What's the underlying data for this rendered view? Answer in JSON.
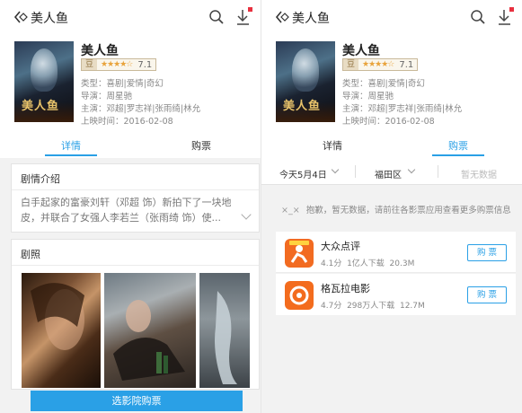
{
  "header": {
    "title": "美人鱼"
  },
  "movie": {
    "title": "美人鱼",
    "rating_source": "豆",
    "stars": "★★★★☆",
    "score": "7.1",
    "genre": "类型：喜剧|爱情|奇幻",
    "director": "导演：周星驰",
    "cast": "主演：邓超|罗志祥|张雨绮|林允",
    "release": "上映时间：2016-02-08",
    "poster_text": "美人鱼"
  },
  "tabs": {
    "details": "详情",
    "tickets": "购票"
  },
  "synopsis": {
    "title": "剧情介绍",
    "text": "白手起家的富豪刘轩（邓超 饰）新拍下了一块地皮，并联合了女强人李若兰（张雨绮 饰）使..."
  },
  "stills": {
    "title": "剧照"
  },
  "bottom": {
    "buy_label": "选影院购票"
  },
  "filters": {
    "date": "今天5月4日",
    "district": "福田区",
    "sort": "暂无数据"
  },
  "notice": {
    "emoticon": "×_×",
    "text": "抱歉，暂无数据，请前往各影票应用查看更多购票信息"
  },
  "apps": [
    {
      "name": "大众点评",
      "score": "4.1分",
      "downloads": "1亿人下载",
      "size": "20.3M",
      "button": "购 票",
      "color": "#f26b21"
    },
    {
      "name": "格瓦拉电影",
      "score": "4.7分",
      "downloads": "298万人下载",
      "size": "12.7M",
      "button": "购 票",
      "color": "#f36c1e"
    }
  ],
  "colors": {
    "accent": "#2aa0e6",
    "background": "#f2f2f2",
    "badge": "#e8303f"
  }
}
